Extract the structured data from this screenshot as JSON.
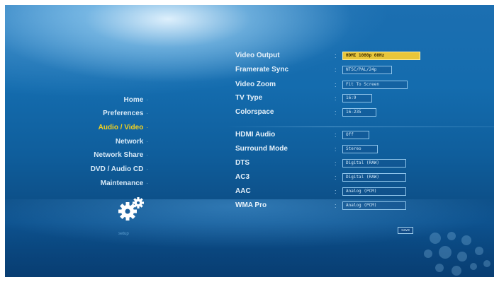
{
  "colors": {
    "background": "#1466a8",
    "menu_text": "#d7e9f7",
    "menu_active": "#f4d21f",
    "value_border": "#8ec4ea",
    "selected_value": "#e8c63a"
  },
  "menu": {
    "items": [
      {
        "label": "Home",
        "active": false
      },
      {
        "label": "Preferences",
        "active": false
      },
      {
        "label": "Audio / Video",
        "active": true
      },
      {
        "label": "Network",
        "active": false
      },
      {
        "label": "Network Share",
        "active": false
      },
      {
        "label": "DVD / Audio CD",
        "active": false
      },
      {
        "label": "Maintenance",
        "active": false
      }
    ]
  },
  "settings": {
    "video": [
      {
        "label": "Video Output",
        "value": "HDMI 1080p 60Hz",
        "selected": true
      },
      {
        "label": "Framerate Sync",
        "value": "NTSC/PAL/24p",
        "selected": false
      },
      {
        "label": "Video Zoom",
        "value": "Fit To Screen",
        "selected": false
      },
      {
        "label": "TV Type",
        "value": "16:9",
        "selected": false
      },
      {
        "label": "Colorspace",
        "value": "16-235",
        "selected": false
      }
    ],
    "audio": [
      {
        "label": "HDMI Audio",
        "value": "Off",
        "selected": false
      },
      {
        "label": "Surround Mode",
        "value": "Stereo",
        "selected": false
      },
      {
        "label": "DTS",
        "value": "Digital (RAW)",
        "selected": false
      },
      {
        "label": "AC3",
        "value": "Digital (RAW)",
        "selected": false
      },
      {
        "label": "AAC",
        "value": "Analog (PCM)",
        "selected": false
      },
      {
        "label": "WMA Pro",
        "value": "Analog (PCM)",
        "selected": false
      }
    ]
  },
  "footer": {
    "section_caption": "setup",
    "save_label": "save",
    "gear_icon": "gear-icon"
  }
}
